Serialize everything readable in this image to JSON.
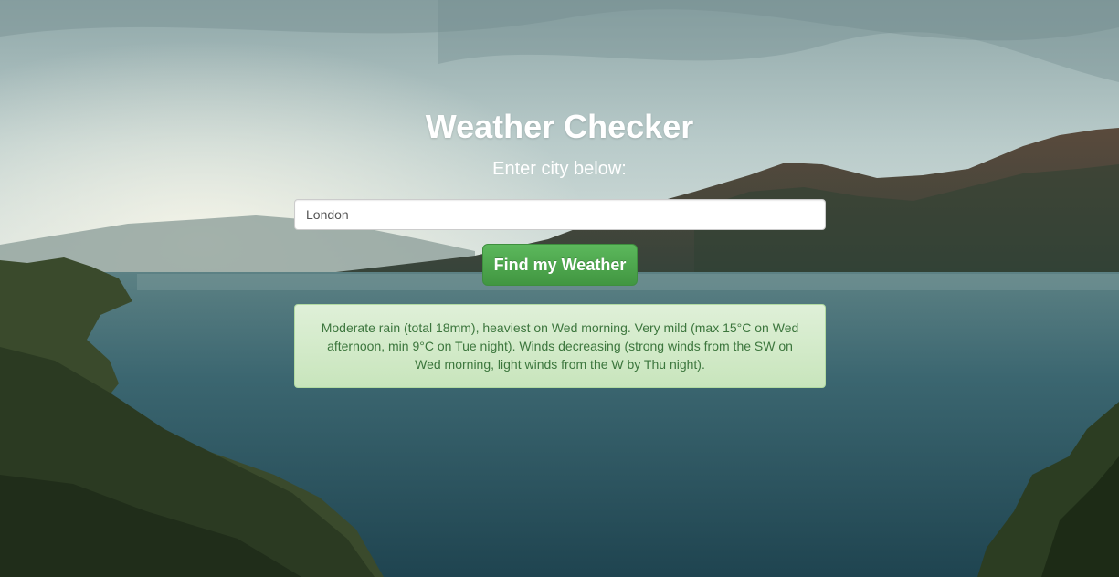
{
  "page": {
    "title": "Weather Checker",
    "subtitle": "Enter city below:"
  },
  "search": {
    "value": "London"
  },
  "button": {
    "label": "Find my Weather"
  },
  "forecast": {
    "text": "Moderate rain (total 18mm), heaviest on Wed morning. Very mild (max 15°C on Wed afternoon, min 9°C on Tue night). Winds decreasing (strong winds from the SW on Wed morning, light winds from the W by Thu night)."
  },
  "colors": {
    "button": "#5cb85c",
    "alert_background": "#dff0d8",
    "alert_text": "#3c763d",
    "lake": "#2f5a66",
    "sky": "#c9d7d6"
  },
  "background": {
    "scene": "landscape-lake-mountains-photo"
  }
}
